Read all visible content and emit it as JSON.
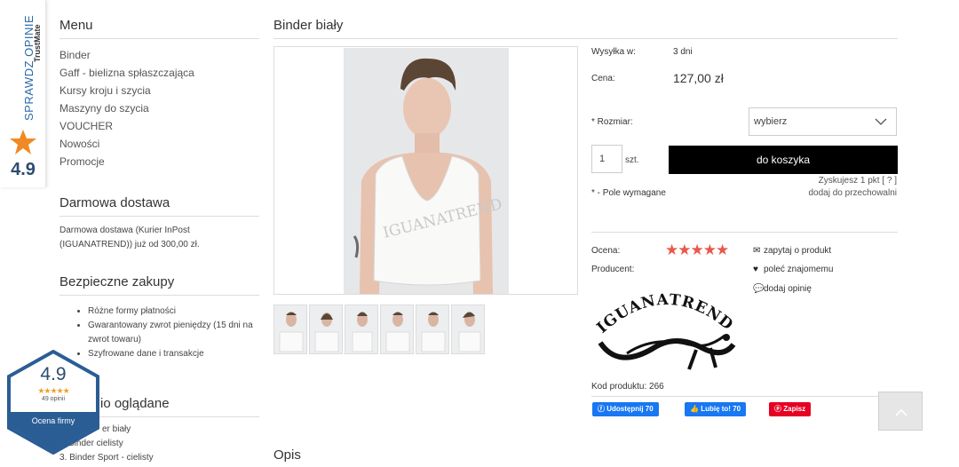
{
  "trust_widget": {
    "vertical_label": "SPRAWDZ OPINIE",
    "brand": "TrustMate",
    "score": "4.9",
    "icon": "star-icon",
    "accent": "#f08a24"
  },
  "sidebar": {
    "menu_title": "Menu",
    "menu_items": [
      {
        "label": "Binder"
      },
      {
        "label": "Gaff - bielizna spłaszczająca"
      },
      {
        "label": "Kursy kroju i szycia"
      },
      {
        "label": "Maszyny do szycia"
      },
      {
        "label": "VOUCHER"
      },
      {
        "label": "Nowości"
      },
      {
        "label": "Promocje"
      }
    ],
    "shipping_title": "Darmowa dostawa",
    "shipping_text": "Darmowa dostawa (Kurier InPost (IGUANATREND)) już od 300,00 zł.",
    "safe_title": "Bezpieczne zakupy",
    "safe_items": [
      {
        "text": "Różne formy płatności"
      },
      {
        "text": "Gwarantowany zwrot pieniędzy (15 dni na zwrot towaru)"
      },
      {
        "text": "Szyfrowane dane i transakcje"
      }
    ],
    "recent_title": "io oglądane",
    "recent_items": [
      {
        "text": "er biały"
      },
      {
        "text": "Binder cielisty"
      },
      {
        "text": "3. Binder Sport - cielisty"
      }
    ]
  },
  "product": {
    "title": "Binder biały",
    "shipping_label": "Wysyłka w:",
    "shipping_value": "3 dni",
    "price_label": "Cena:",
    "price": "127,00 zł",
    "size_label": "* Rozmiar:",
    "size_selected": "wybierz",
    "quantity": "1",
    "quantity_unit": "szt.",
    "add_to_cart": "do koszyka",
    "points_text": "Zyskujesz 1 pkt [ ? ]",
    "store_link": "dodaj do przechowalni",
    "required_note": "* - Pole wymagane",
    "rating_label": "Ocena:",
    "rating_stars": "★★★★★",
    "producer_label": "Producent:",
    "producer_logo_text": "IGUANATREND",
    "code_label": "Kod produktu:",
    "code_value": "266",
    "actions": [
      {
        "label": "zapytaj o produkt",
        "icon": "envelope-icon"
      },
      {
        "label": "poleć znajomemu",
        "icon": "heart-icon"
      },
      {
        "label": "dodaj opinię",
        "icon": "comment-icon"
      }
    ],
    "thumbnail_count": 6,
    "image_watermark": "IGUANATREND"
  },
  "social": {
    "share": "Udostępnij 70",
    "like": "Lubię to! 70",
    "pin": "Zapisz"
  },
  "description_title": "Opis",
  "rating_badge": {
    "score": "4.9",
    "stars": "★★★★★",
    "count": "49 opinii",
    "label": "Ocena firmy"
  }
}
